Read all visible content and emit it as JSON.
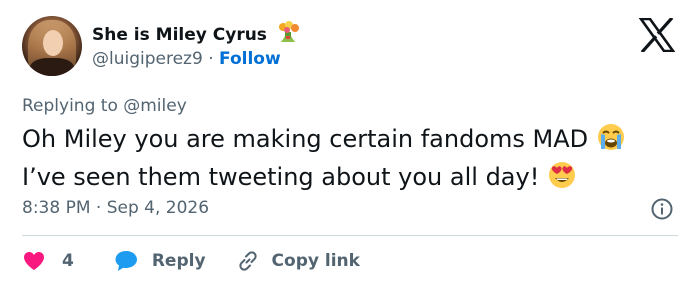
{
  "author": {
    "display_name": "She is Miley Cyrus",
    "name_emoji": "💐",
    "handle": "@luigiperez9",
    "separator": " · ",
    "follow_label": "Follow"
  },
  "reply_context": {
    "prefix": "Replying to ",
    "mention": "@miley"
  },
  "tweet": {
    "line1": "Oh Miley you are making certain fandoms MAD",
    "line2": "I’ve seen them tweeting about you all day!"
  },
  "meta": {
    "time": "8:38 PM",
    "separator": " · ",
    "date": "Sep 4, 2026"
  },
  "actions": {
    "like_count": "4",
    "reply_label": "Reply",
    "copy_link_label": "Copy link"
  },
  "colors": {
    "link_blue": "#006fd6",
    "like_pink": "#f91880",
    "reply_blue": "#1d9bf0",
    "muted_text": "#536471",
    "divider": "#cfd9de"
  },
  "icons": [
    "x-logo-icon",
    "info-icon",
    "heart-icon",
    "reply-bubble-icon",
    "link-icon",
    "bouquet-emoji",
    "crying-emoji",
    "heart-eyes-emoji"
  ]
}
